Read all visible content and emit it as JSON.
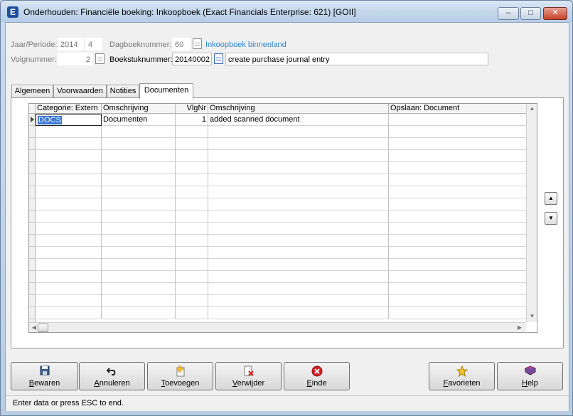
{
  "window": {
    "title": "Onderhouden: Financiële boeking: Inkoopboek (Exact Financials Enterprise: 621) [GOII]",
    "app_icon_letter": "E",
    "min_symbol": "–",
    "max_symbol": "□",
    "close_symbol": "✕"
  },
  "header": {
    "period_label": "Jaar/Periode:",
    "year": "2014",
    "period": "4",
    "journal_label": "Dagboeknummer:",
    "journal_number": "60",
    "journal_name": "Inkoopboek binnenland",
    "seq_label": "Volgnummer:",
    "seq_number": "2",
    "entry_label": "Boekstuknummer:",
    "entry_number": "20140002",
    "description": "create purchase journal entry"
  },
  "tabs": [
    {
      "label": "Algemeen"
    },
    {
      "label": "Voorwaarden"
    },
    {
      "label": "Notities"
    },
    {
      "label": "Documenten",
      "active": true
    }
  ],
  "grid": {
    "columns": [
      "Categorie: Extern",
      "Omschrijving",
      "VlgNr",
      "Omschrijving",
      "Opslaan: Document"
    ],
    "rows": [
      {
        "category": "DOCS",
        "description": "Documenten",
        "seq": "1",
        "doc_description": "added scanned document",
        "save_document": ""
      }
    ],
    "up_arrow": "▲",
    "down_arrow": "▼",
    "left_arrow": "◀",
    "right_arrow": "▶"
  },
  "side_buttons": {
    "up": "▲",
    "down": "▼"
  },
  "buttons": [
    {
      "name": "save",
      "label": "Bewaren",
      "icon": "floppy-icon"
    },
    {
      "name": "cancel",
      "label": "Annuleren",
      "icon": "undo-icon"
    },
    {
      "name": "add",
      "label": "Toevoegen",
      "icon": "add-document-icon"
    },
    {
      "name": "delete",
      "label": "Verwijder",
      "icon": "delete-document-icon"
    },
    {
      "name": "end",
      "label": "Einde",
      "icon": "close-circle-icon"
    },
    {
      "name": "favorites",
      "label": "Favorieten",
      "icon": "star-icon"
    },
    {
      "name": "help",
      "label": "Help",
      "icon": "book-icon"
    }
  ],
  "status": {
    "text": "Enter data or press ESC to end."
  },
  "colors": {
    "link": "#2d86d4",
    "selection": "#3a76d6",
    "end_red": "#d22020",
    "star_yellow": "#f2c12e"
  }
}
